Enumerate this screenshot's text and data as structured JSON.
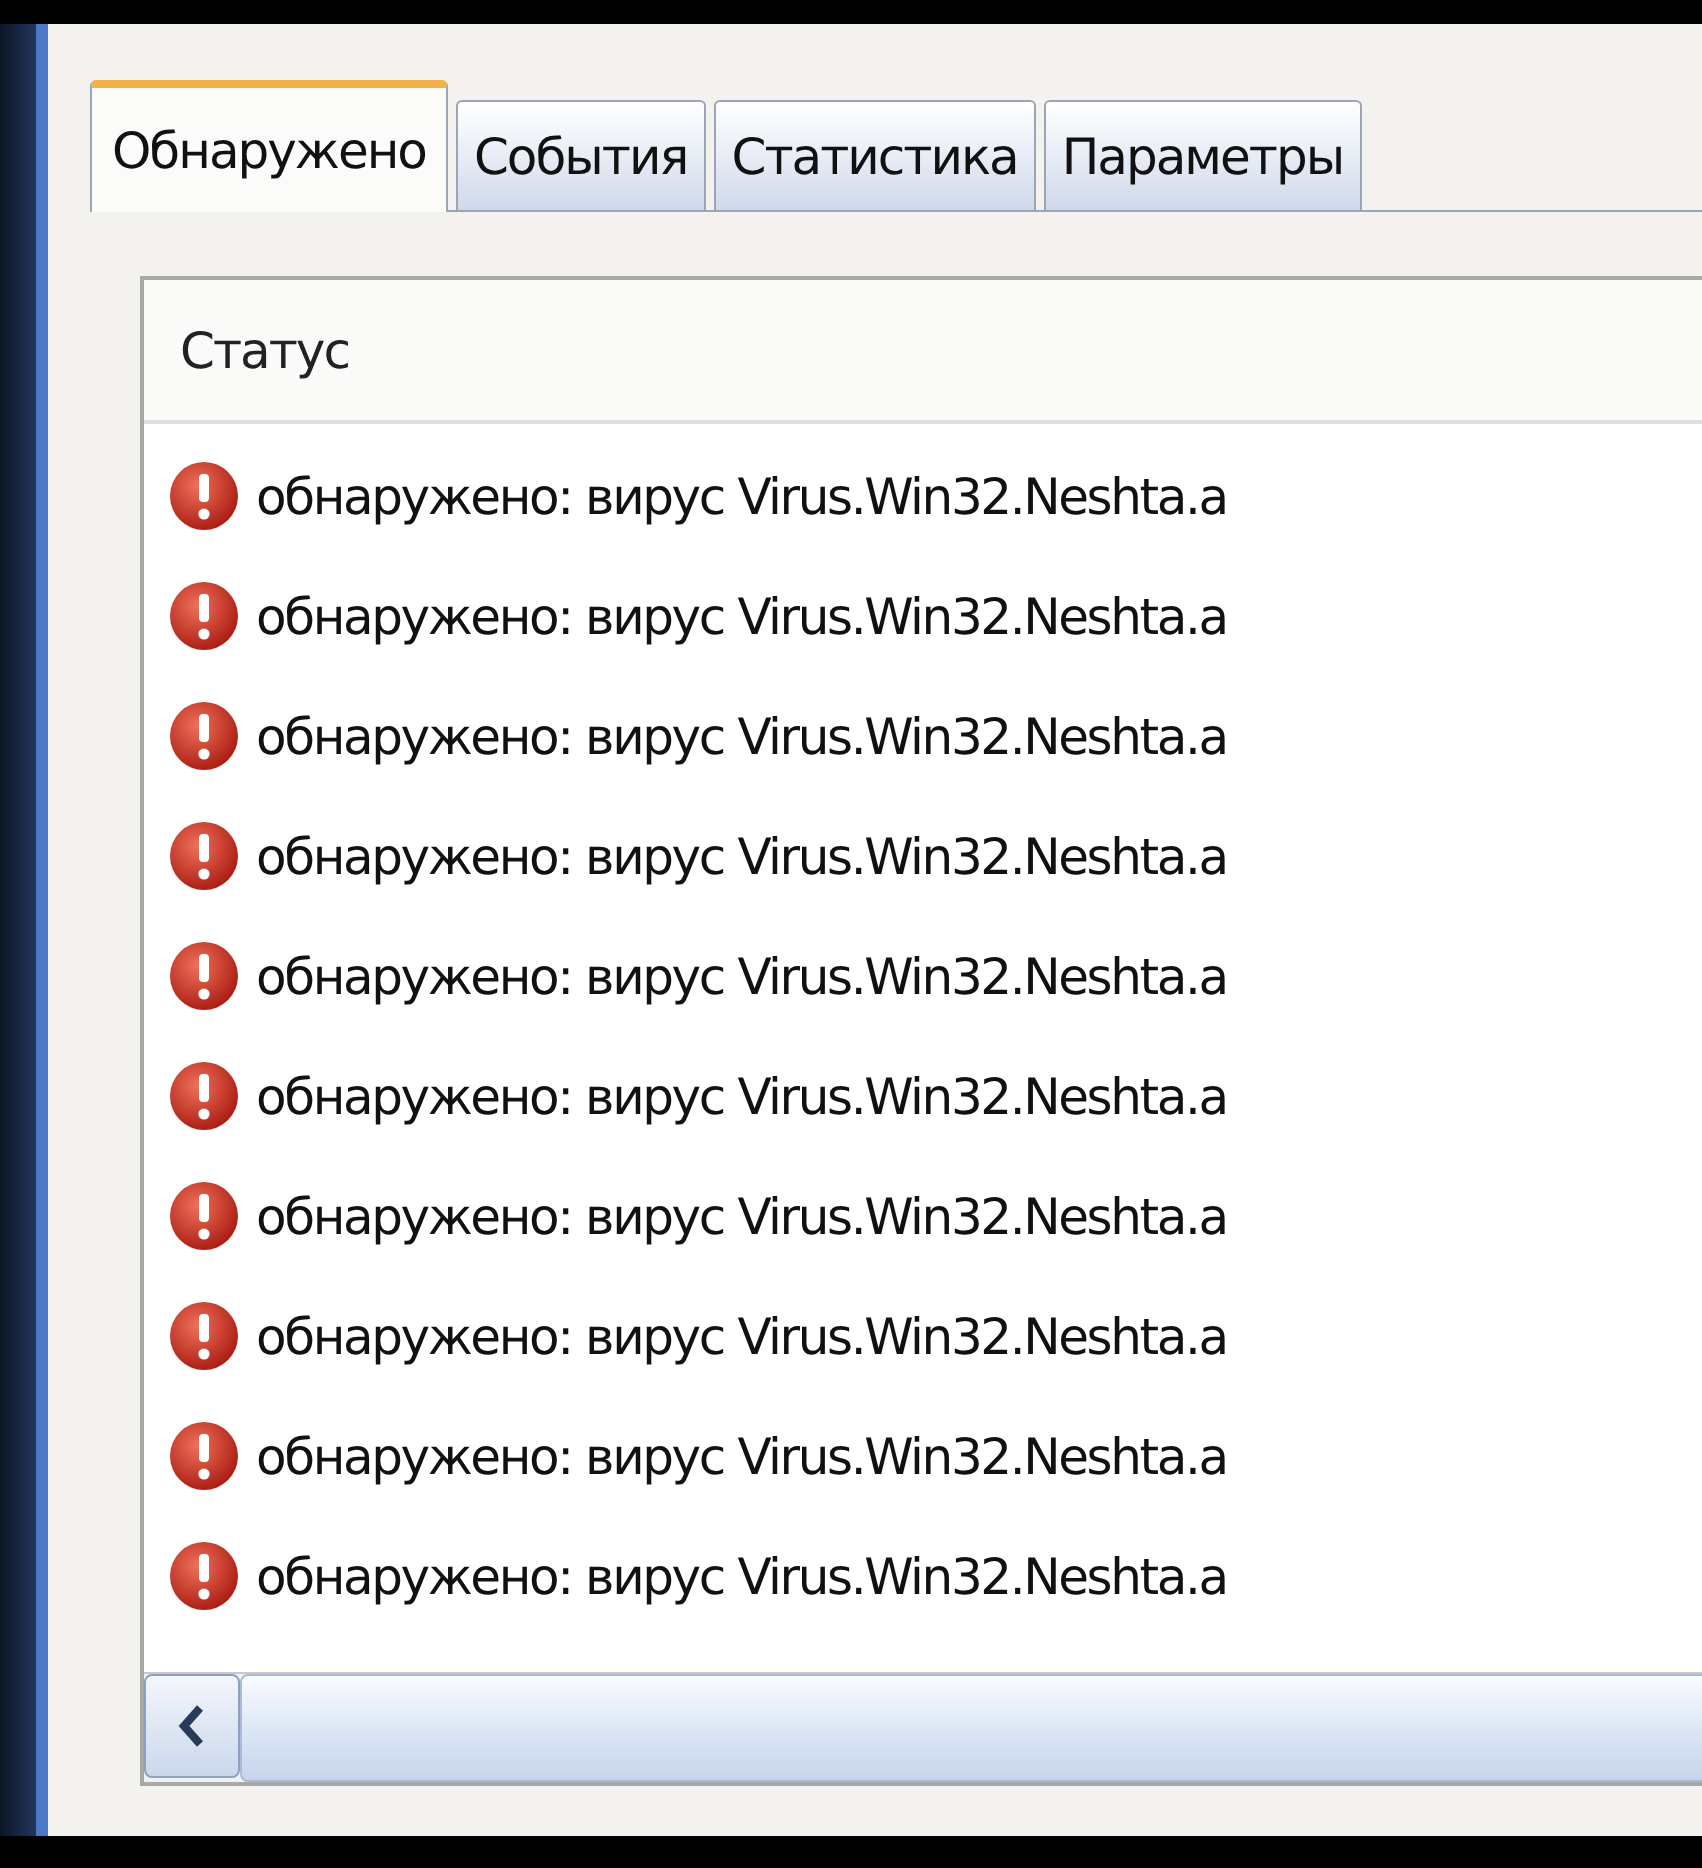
{
  "tabs": [
    {
      "label": "Обнаружено",
      "selected": true
    },
    {
      "label": "События",
      "selected": false
    },
    {
      "label": "Статистика",
      "selected": false
    },
    {
      "label": "Параметры",
      "selected": false
    }
  ],
  "table": {
    "columns": [
      "Статус"
    ],
    "rows": [
      {
        "status": "обнаружено: вирус Virus.Win32.Neshta.a"
      },
      {
        "status": "обнаружено: вирус Virus.Win32.Neshta.a"
      },
      {
        "status": "обнаружено: вирус Virus.Win32.Neshta.a"
      },
      {
        "status": "обнаружено: вирус Virus.Win32.Neshta.a"
      },
      {
        "status": "обнаружено: вирус Virus.Win32.Neshta.a"
      },
      {
        "status": "обнаружено: вирус Virus.Win32.Neshta.a"
      },
      {
        "status": "обнаружено: вирус Virus.Win32.Neshta.a"
      },
      {
        "status": "обнаружено: вирус Virus.Win32.Neshta.a"
      },
      {
        "status": "обнаружено: вирус Virus.Win32.Neshta.a"
      },
      {
        "status": "обнаружено: вирус Virus.Win32.Neshta.a"
      }
    ]
  }
}
